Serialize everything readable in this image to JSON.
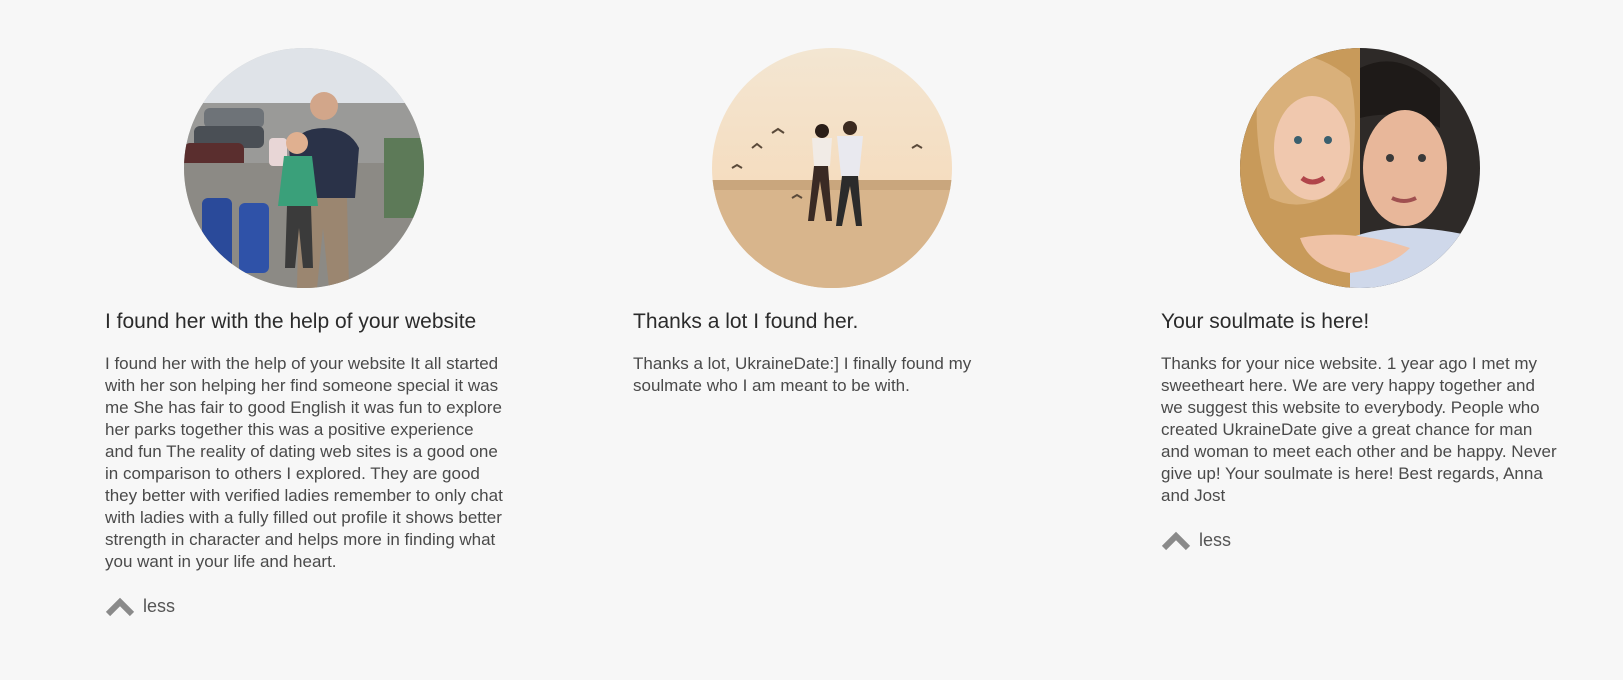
{
  "testimonials": [
    {
      "title": "I found her with the help of your website",
      "text": "I found her with the help of your website It all started with her son helping her find someone special it was me She has fair to good English it was fun to explore her parks together this was a positive experience and fun The reality of dating web sites is a good one in comparison to others I explored. They are good they better with verified ladies remember to only chat with ladies with a fully filled out profile it shows better strength in character and helps more in finding what you want in your life and heart.",
      "toggle_label": "less",
      "photo_icon": "couple-at-parking-lot-photo"
    },
    {
      "title": "Thanks a lot I found her.",
      "text": "Thanks a lot, UkraineDate:] I finally found my soulmate who I am meant to be with.",
      "photo_icon": "couple-running-on-beach-photo"
    },
    {
      "title": "Your soulmate is here!",
      "text": "Thanks for your nice website. 1 year ago I met my sweetheart here. We are very happy together and we suggest this website to everybody. People who created UkraineDate give a great chance for man and woman to meet each other and be happy. Never give up! Your soulmate is here! Best regards, Anna and Jost",
      "toggle_label": "less",
      "photo_icon": "couple-portrait-photo"
    }
  ],
  "colors": {
    "background": "#f7f7f7",
    "title": "#2b2b2b",
    "text": "#4a4a4a",
    "chevron": "#8a8a8a"
  }
}
